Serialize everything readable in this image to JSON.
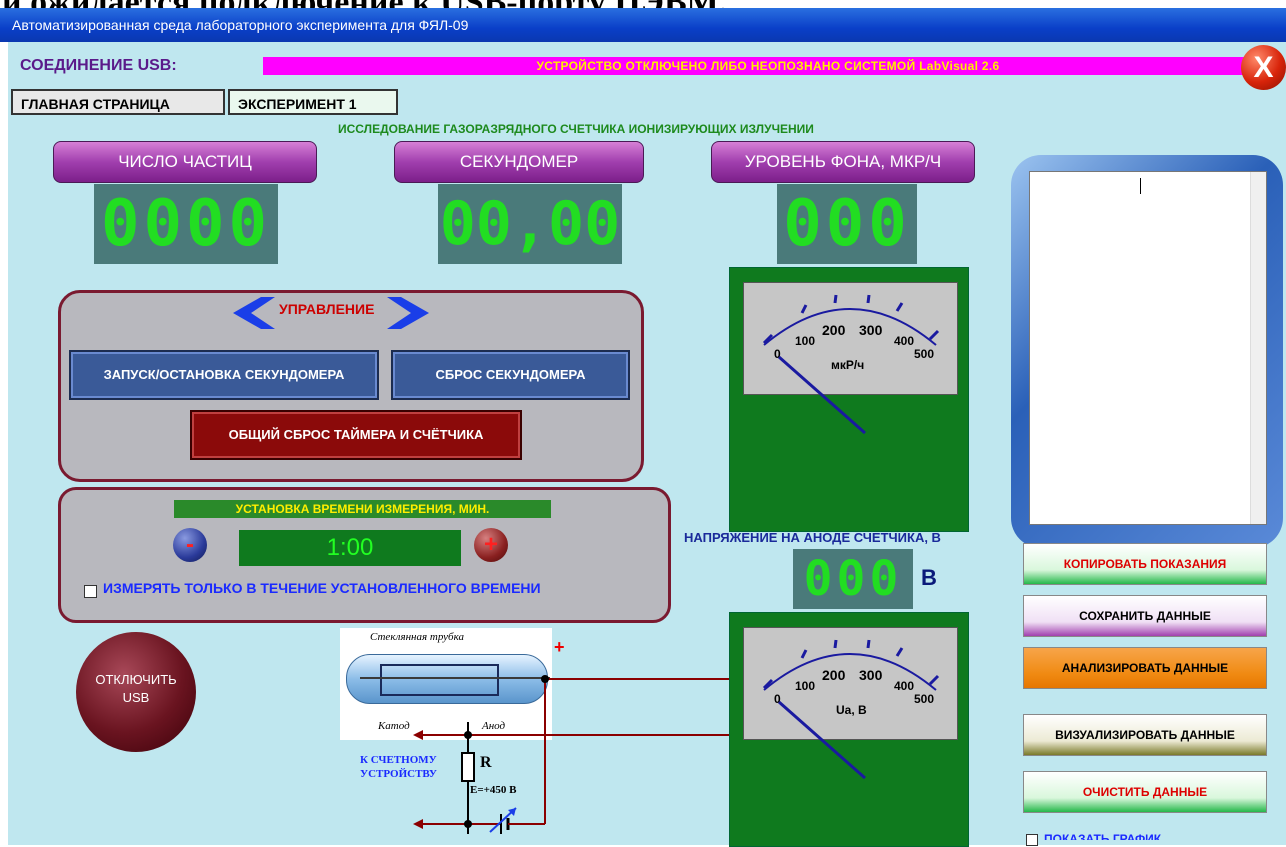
{
  "document_fragment": "и ожидается подключение к USB-порту ПЭВМ.",
  "window": {
    "title": "Автоматизированная среда лабораторного эксперимента для ФЯЛ-09"
  },
  "connection": {
    "label": "СОЕДИНЕНИЕ USB:",
    "status": "УСТРОЙСТВО ОТКЛЮЧЕНО ЛИБО НЕОПОЗНАНО СИСТЕМОЙ LabVisual 2.6",
    "close_symbol": "X"
  },
  "tabs": [
    {
      "label": "ГЛАВНАЯ СТРАНИЦА"
    },
    {
      "label": "ЭКСПЕРИМЕНТ 1"
    }
  ],
  "experiment_title": "ИССЛЕДОВАНИЕ ГАЗОРАЗРЯДНОГО СЧЕТЧИКА  ИОНИЗИРУЮЩИХ ИЗЛУЧЕНИИ",
  "indicators": {
    "particles": {
      "label": "ЧИСЛО ЧАСТИЦ",
      "value": "0000"
    },
    "stopwatch": {
      "label": "СЕКУНДОМЕР",
      "value": "00,00"
    },
    "background": {
      "label": "УРОВЕНЬ ФОНА, МКР/Ч",
      "value": "000"
    }
  },
  "control": {
    "title": "УПРАВЛЕНИЕ",
    "start_stop": "ЗАПУСК/ОСТАНОВКА СЕКУНДОМЕРА",
    "reset_stopwatch": "СБРОС СЕКУНДОМЕРА",
    "reset_all": "ОБЩИЙ СБРОС ТАЙМЕРА И СЧЁТЧИКА"
  },
  "timing": {
    "title": "УСТАНОВКА ВРЕМЕНИ ИЗМЕРЕНИЯ, МИН.",
    "minus": "-",
    "plus": "+",
    "value": "1:00",
    "checkbox_label": "ИЗМЕРЯТЬ ТОЛЬКО В ТЕЧЕНИЕ УСТАНОВЛЕННОГО ВРЕМЕНИ",
    "checked": false
  },
  "disconnect_button": {
    "line1": "ОТКЛЮЧИТЬ",
    "line2": "USB"
  },
  "meter_background": {
    "ticks": [
      "0",
      "100",
      "200",
      "300",
      "400",
      "500"
    ],
    "unit": "мкР/ч",
    "needle_value": 0
  },
  "anode": {
    "title": "НАПРЯЖЕНИЕ НА АНОДЕ СЧЕТЧИКА, В",
    "value": "000",
    "unit": "В"
  },
  "meter_anode": {
    "ticks": [
      "0",
      "100",
      "200",
      "300",
      "400",
      "500"
    ],
    "unit": "Ua, B",
    "needle_value": 0
  },
  "circuit": {
    "tube_label": "Стеклянная трубка",
    "cathode": "Катод",
    "anode": "Анод",
    "plus": "+",
    "counter_label_1": "К СЧЕТНОМУ",
    "counter_label_2": "УСТРОЙСТВУ",
    "resistor": "R",
    "source": "E=+450 В"
  },
  "actions": [
    {
      "label": "КОПИРОВАТЬ ПОКАЗАНИЯ",
      "text_color": "#dd0000",
      "gradient": [
        "#ffffff",
        "#d9f7dc",
        "#25b84a"
      ]
    },
    {
      "label": "СОХРАНИТЬ ДАННЫЕ",
      "text_color": "#000000",
      "gradient": [
        "#ffffff",
        "#f0e0f5",
        "#a13fae"
      ]
    },
    {
      "label": "АНАЛИЗИРОВАТЬ ДАННЫЕ",
      "text_color": "#000000",
      "gradient": [
        "#f7a54a",
        "#f08a12",
        "#e67600"
      ]
    },
    {
      "label": "ВИЗУАЛИЗИРОВАТЬ ДАННЫЕ",
      "text_color": "#000000",
      "gradient": [
        "#ffffff",
        "#ecead4",
        "#7a7a2a"
      ]
    },
    {
      "label": "ОЧИСТИТЬ ДАННЫЕ",
      "text_color": "#dd0000",
      "gradient": [
        "#ffffff",
        "#d9f7dc",
        "#25b84a"
      ]
    }
  ],
  "show_graph": {
    "label": "ПОКАЗАТЬ ГРАФИК"
  }
}
